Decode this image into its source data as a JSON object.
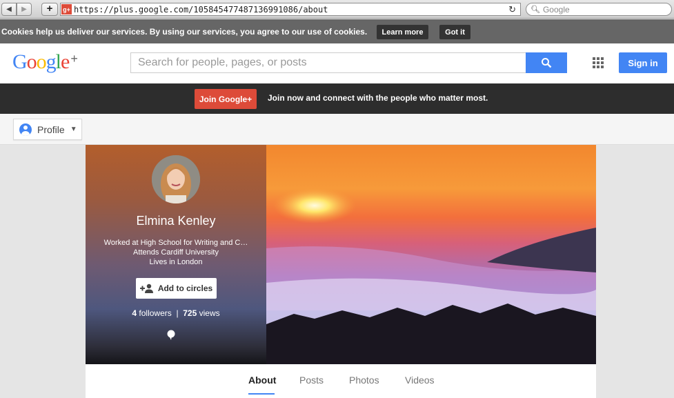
{
  "browser": {
    "url": "https://plus.google.com/105845477487136991086/about",
    "search_placeholder": "Google",
    "favicon_text": "g+"
  },
  "cookie_bar": {
    "message": "Cookies help us deliver our services. By using our services, you agree to our use of cookies.",
    "learn_more": "Learn more",
    "got_it": "Got it"
  },
  "header": {
    "logo_letters": [
      "G",
      "o",
      "o",
      "g",
      "l",
      "e"
    ],
    "logo_colors": [
      "#4285f4",
      "#ea4335",
      "#fbbc05",
      "#4285f4",
      "#34a853",
      "#ea4335"
    ],
    "logo_plus": "+",
    "search_placeholder": "Search for people, pages, or posts",
    "sign_in": "Sign in",
    "accent": "#4285f4"
  },
  "join_bar": {
    "button": "Join Google+",
    "text": "Join now and connect with the people who matter most.",
    "button_color": "#dd4b39"
  },
  "subnav": {
    "profile_label": "Profile"
  },
  "profile": {
    "name": "Elmina Kenley",
    "bio_lines": [
      "Worked at High School for Writing and C…",
      "Attends Cardiff University",
      "Lives in London"
    ],
    "add_to_circles": "Add to circles",
    "followers_count": "4",
    "followers_label": "followers",
    "separator": "|",
    "views_count": "725",
    "views_label": "views"
  },
  "tabs": [
    {
      "label": "About",
      "active": true
    },
    {
      "label": "Posts",
      "active": false
    },
    {
      "label": "Photos",
      "active": false
    },
    {
      "label": "Videos",
      "active": false
    }
  ]
}
